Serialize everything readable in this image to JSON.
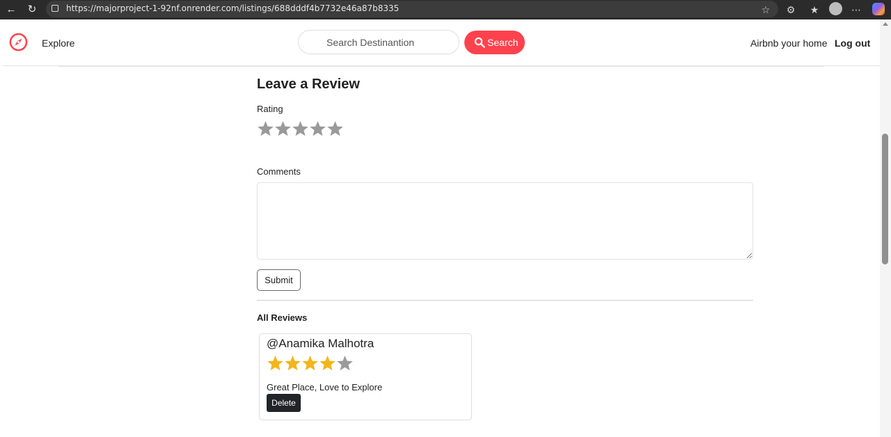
{
  "browser": {
    "url": "https://majorproject-1-92nf.onrender.com/listings/688dddf4b7732e46a87b8335"
  },
  "navbar": {
    "explore_label": "Explore",
    "search_placeholder": "Search Destinantion",
    "search_button_label": "Search",
    "host_link_label": "Airbnb your home",
    "logout_label": "Log out",
    "brand_color": "#fe424d"
  },
  "review_form": {
    "title": "Leave a Review",
    "rating_label": "Rating",
    "rating_value": 0,
    "rating_max": 5,
    "comments_label": "Comments",
    "comments_value": "",
    "submit_label": "Submit"
  },
  "reviews": {
    "heading": "All Reviews",
    "items": [
      {
        "author": "@Anamika Malhotra",
        "rating": 4,
        "rating_max": 5,
        "comment": "Great Place, Love to Explore",
        "delete_label": "Delete"
      }
    ]
  },
  "colors": {
    "star_filled": "#f2b51b",
    "star_empty": "#9a9a9a"
  }
}
